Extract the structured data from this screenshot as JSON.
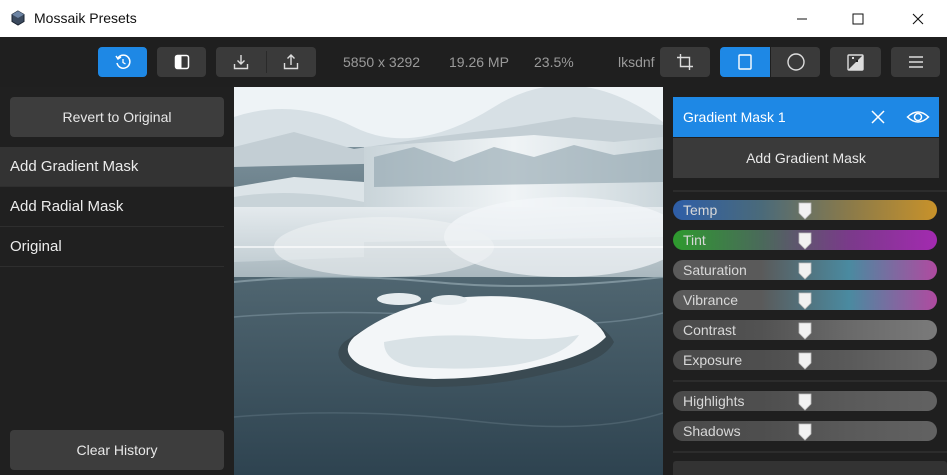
{
  "window": {
    "title": "Mossaik Presets",
    "icons": {
      "app": "app-logo-icon",
      "minimize": "minimize-icon",
      "maximize": "maximize-icon",
      "close": "close-icon"
    }
  },
  "toolbar": {
    "dimensions": "5850 x 3292",
    "megapixels": "19.26 MP",
    "zoom": "23.5%",
    "preset_name": "lksdnf",
    "icons": [
      "history-icon",
      "compare-split-icon",
      "download-icon",
      "share-icon",
      "crop-icon",
      "gradient-mask-icon",
      "radial-mask-icon",
      "brush-mask-icon",
      "menu-icon"
    ],
    "accent": "#1e88e5"
  },
  "history": {
    "revert_label": "Revert to Original",
    "items": [
      "Add Gradient Mask",
      "Add Radial Mask",
      "Original"
    ],
    "selected_index": 0,
    "clear_label": "Clear History"
  },
  "mask_panel": {
    "title": "Gradient Mask 1",
    "add_label": "Add Gradient Mask",
    "icons": {
      "close": "close-icon",
      "visibility": "eye-icon"
    },
    "sliders": [
      {
        "label": "Temp",
        "value": 0.5,
        "colors": [
          "#2e5ea8",
          "#4a6a7a",
          "#8a7a4a",
          "#c8922a"
        ]
      },
      {
        "label": "Tint",
        "value": 0.5,
        "colors": [
          "#2e9a2e",
          "#4a6a5a",
          "#7a3a8a",
          "#a32ab0"
        ]
      },
      {
        "label": "Saturation",
        "value": 0.5,
        "colors": [
          "#5a5a5a",
          "#5a5a5a",
          "#4a8aa0",
          "#b04aa0"
        ]
      },
      {
        "label": "Vibrance",
        "value": 0.5,
        "colors": [
          "#5a5a5a",
          "#5a5a5a",
          "#4a8aa0",
          "#b04aa0"
        ]
      },
      {
        "label": "Contrast",
        "value": 0.5,
        "colors": [
          "#4a4a4a",
          "#525252",
          "#6a6a6a",
          "#7a7a7a"
        ]
      },
      {
        "label": "Exposure",
        "value": 0.5,
        "colors": [
          "#4a4a4a",
          "#4e4e4e",
          "#5a5a5a",
          "#6a6a6a"
        ]
      },
      {
        "label": "Highlights",
        "value": 0.5,
        "colors": [
          "#4a4a4a",
          "#4e4e4e",
          "#5a5a5a",
          "#626262"
        ]
      },
      {
        "label": "Shadows",
        "value": 0.5,
        "colors": [
          "#4a4a4a",
          "#4e4e4e",
          "#5a5a5a",
          "#626262"
        ]
      }
    ]
  }
}
